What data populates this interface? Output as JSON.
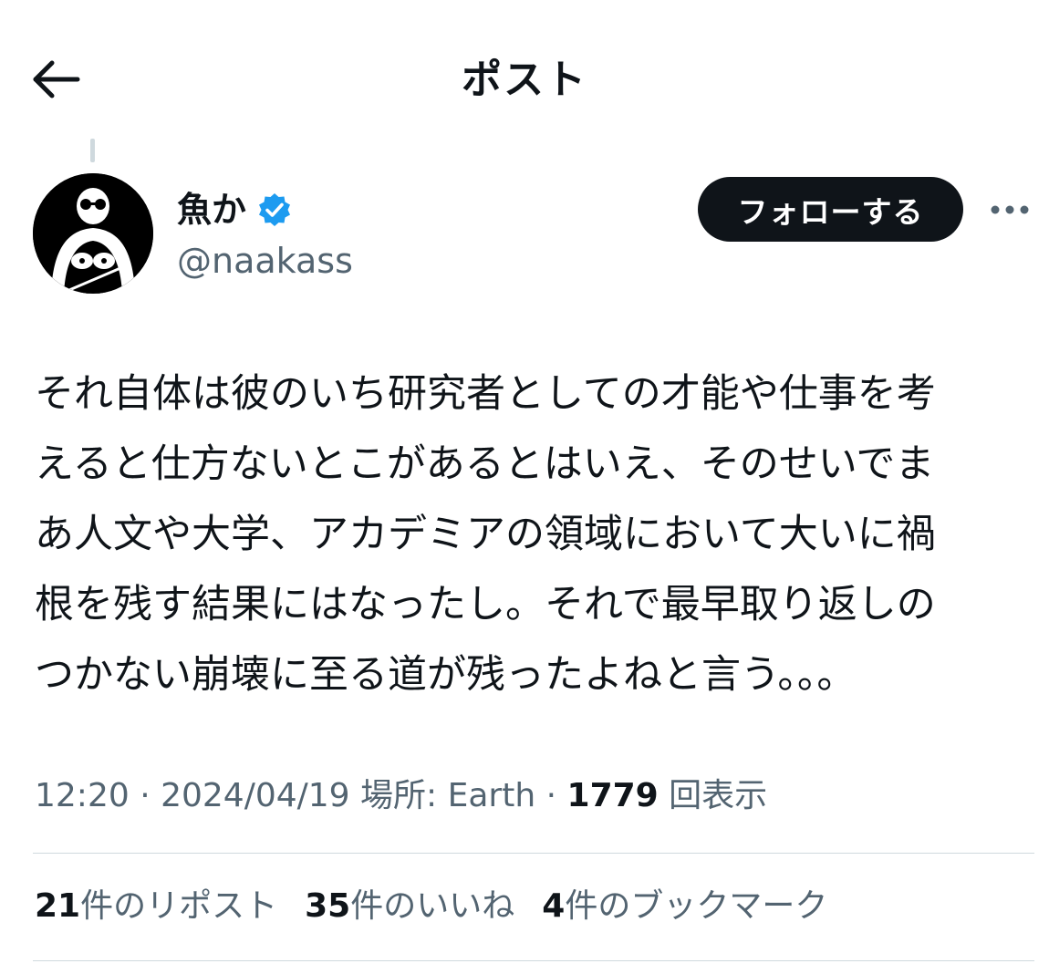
{
  "header": {
    "title": "ポスト",
    "back_icon": "arrow-left-icon"
  },
  "author": {
    "display_name": "魚か",
    "handle": "@naakass",
    "verified_icon": "verified-badge-icon",
    "verified_color": "#1d9bf0"
  },
  "actions": {
    "follow_label": "フォローする",
    "more_icon": "more-horizontal-icon"
  },
  "tweet": {
    "lines": [
      "それ自体は彼のいち研究者としての才能や仕事を考",
      "えると仕方ないとこがあるとはいえ、そのせいでま",
      "あ人文や大学、アカデミアの領域において大いに禍",
      "根を残す結果にはなったし。それで最早取り返しの",
      "つかない崩壊に至る道が残ったよねと言う。。。"
    ]
  },
  "meta": {
    "time": "12:20",
    "sep1": " · ",
    "date": "2024/04/19",
    "location_label": "場所: Earth",
    "sep2": " · ",
    "views_count": "1779",
    "views_label": "回表示"
  },
  "stats": [
    {
      "count": "21",
      "label": "件のリポスト"
    },
    {
      "count": "35",
      "label": "件のいいね"
    },
    {
      "count": "4",
      "label": "件のブックマーク"
    }
  ],
  "colors": {
    "text_primary": "#0f1419",
    "text_secondary": "#536471",
    "divider": "#cfd9de",
    "follow_bg": "#0f1419"
  }
}
